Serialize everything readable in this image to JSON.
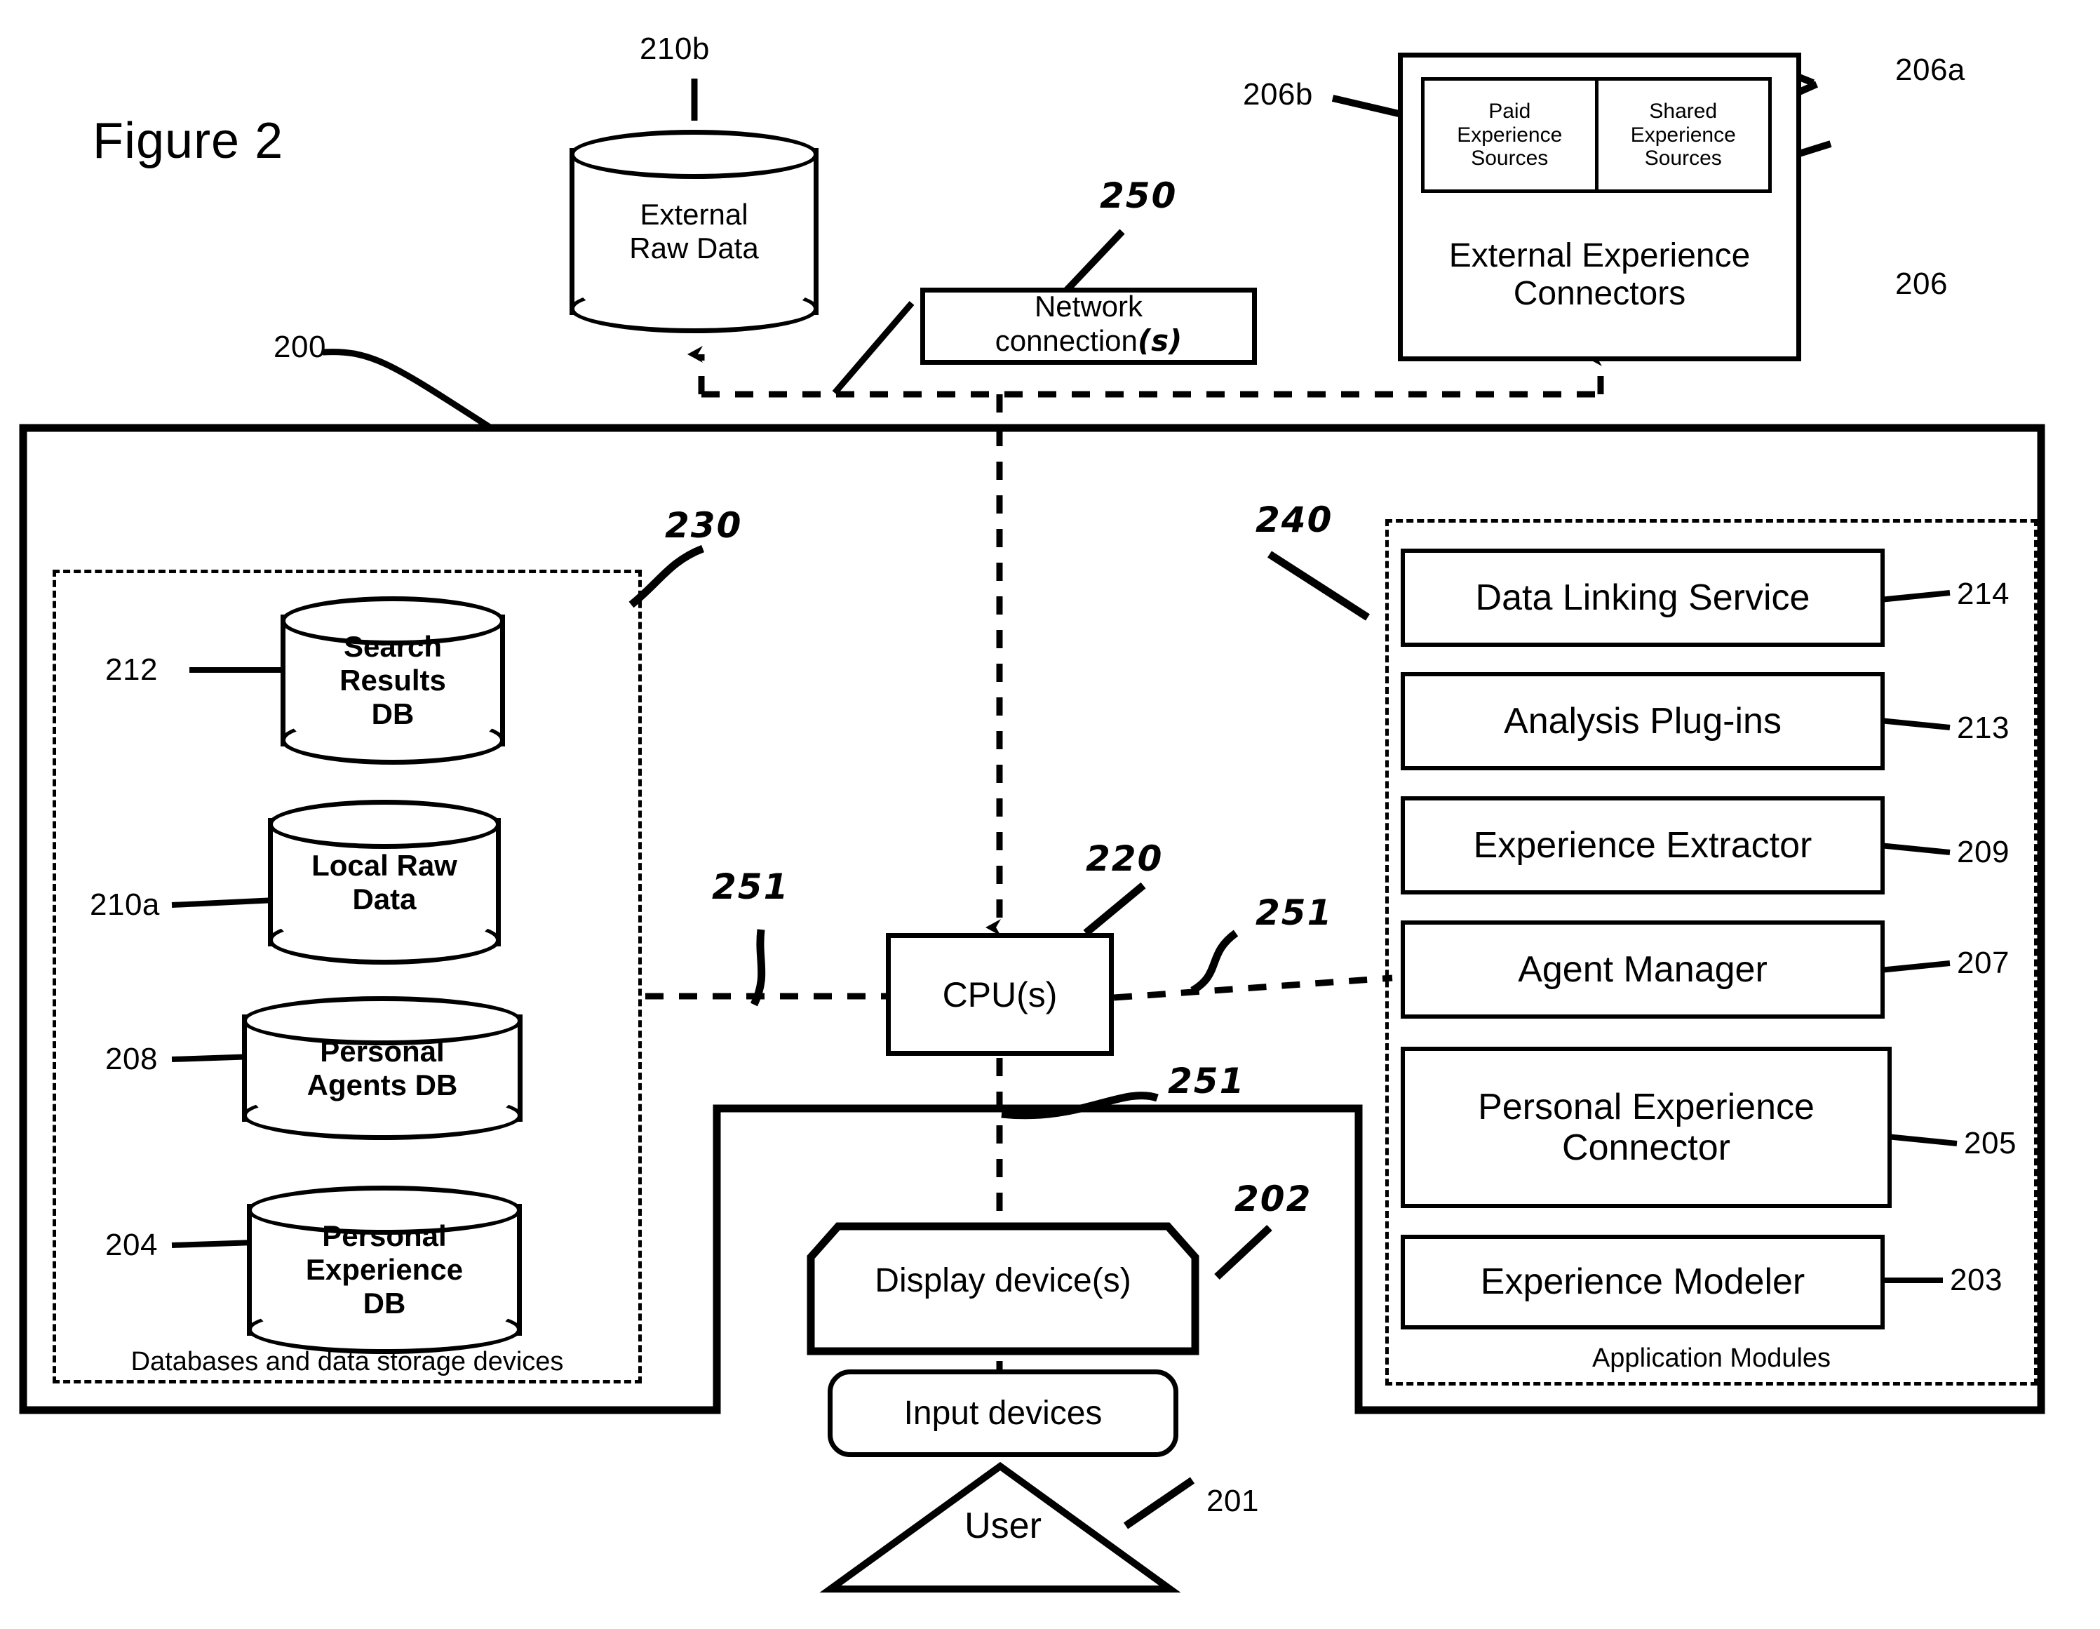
{
  "figure": {
    "title": "Figure 2"
  },
  "refs": {
    "system": "200",
    "external_raw_data": "210b",
    "network": "250",
    "ext_conn_inner": "206b",
    "ext_conn_inner_right": "206a",
    "ext_conn_outer": "206",
    "db_group": "230",
    "modules_group": "240",
    "search_results_db": "212",
    "local_raw_data": "210a",
    "personal_agents_db": "208",
    "personal_experience_db": "204",
    "cpu": "220",
    "bus_left": "251",
    "bus_right": "251",
    "bus_bottom": "251",
    "display": "202",
    "user": "201",
    "data_linking_service": "214",
    "analysis_plugins": "213",
    "experience_extractor": "209",
    "agent_manager": "207",
    "personal_experience_connector": "205",
    "experience_modeler": "203"
  },
  "external_raw_data": {
    "label": "External\nRaw Data",
    "line1": "External",
    "line2": "Raw Data"
  },
  "network": {
    "line1": "Network",
    "line2": "connection",
    "suffix": "(s)"
  },
  "external_connectors": {
    "caption_line1": "External Experience",
    "caption_line2": "Connectors",
    "sources": [
      {
        "line1": "Paid",
        "line2": "Experience",
        "line3": "Sources"
      },
      {
        "line1": "Shared",
        "line2": "Experience",
        "line3": "Sources"
      }
    ]
  },
  "databases": {
    "group_caption": "Databases and data storage devices",
    "items": [
      {
        "line1": "Search",
        "line2": "Results",
        "line3": "DB"
      },
      {
        "line1": "Local Raw",
        "line2": "Data",
        "line3": ""
      },
      {
        "line1": "Personal",
        "line2": "Agents DB",
        "line3": ""
      },
      {
        "line1": "Personal",
        "line2": "Experience",
        "line3": "DB"
      }
    ]
  },
  "cpu": {
    "label": "CPU(s)"
  },
  "io": {
    "display": "Display device(s)",
    "input": "Input devices",
    "user": "User"
  },
  "modules": {
    "group_caption": "Application Modules",
    "items": [
      {
        "label": "Data Linking Service"
      },
      {
        "label": "Analysis Plug-ins"
      },
      {
        "label": "Experience Extractor"
      },
      {
        "label": "Agent Manager"
      },
      {
        "label": "Personal Experience Connector",
        "line1": "Personal Experience",
        "line2": "Connector"
      },
      {
        "label": "Experience  Modeler"
      }
    ]
  },
  "colors": {
    "ink": "#000000",
    "paper": "#ffffff"
  }
}
